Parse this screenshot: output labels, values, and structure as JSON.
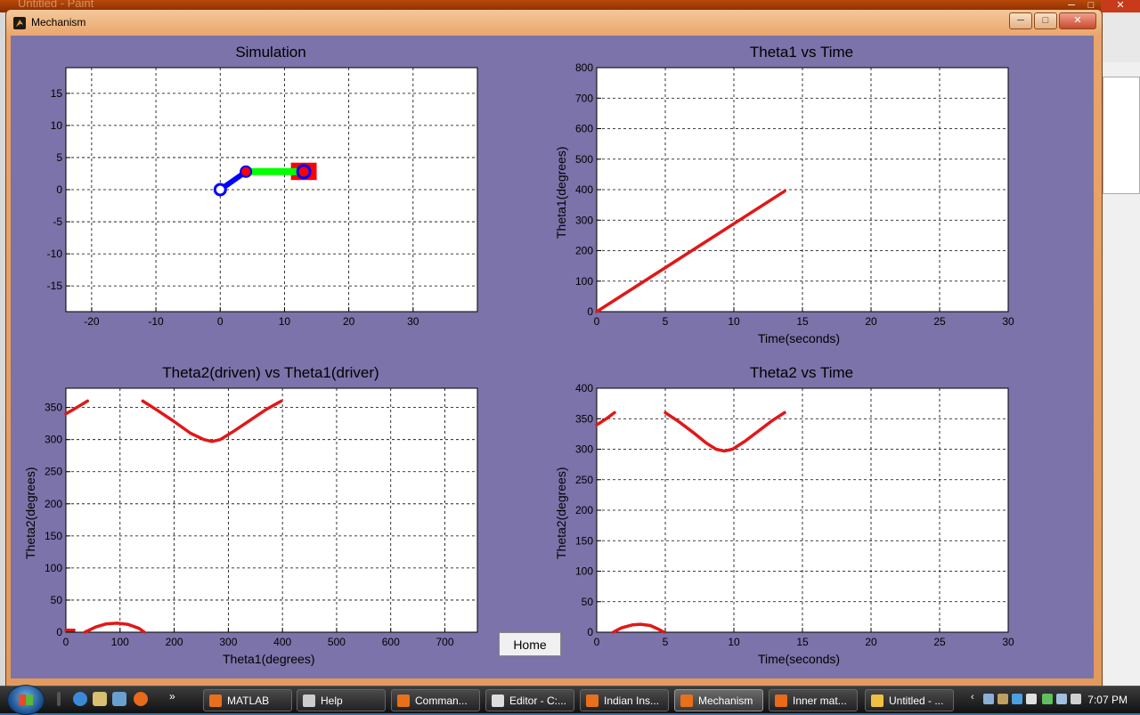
{
  "background_window": {
    "title": "Untitled - Paint"
  },
  "window": {
    "title": "Mechanism",
    "buttons": {
      "minimize": "─",
      "maximize": "□",
      "close": "✕"
    }
  },
  "home_button": {
    "label": "Home"
  },
  "colors": {
    "client_bg": "#7b73a9",
    "plot_line": "#e01818",
    "link_green": "#00ff00",
    "link_blue": "#0000ff",
    "slider_red": "#ff0000"
  },
  "chart_data": [
    {
      "type": "scatter",
      "title": "Simulation",
      "xlabel": "",
      "ylabel": "",
      "xlim": [
        -24,
        40
      ],
      "ylim": [
        -19,
        19
      ],
      "xticks": [
        -20,
        -10,
        0,
        10,
        20,
        30
      ],
      "yticks": [
        -15,
        -10,
        -5,
        0,
        5,
        10,
        15
      ],
      "grid": true,
      "mechanism": {
        "ground_pivot": [
          0,
          0
        ],
        "crank_end": [
          4,
          2.8
        ],
        "slider_pin": [
          13,
          2.8
        ],
        "slider_block": {
          "x": [
            11,
            15
          ],
          "y": [
            1.5,
            4.2
          ]
        }
      }
    },
    {
      "type": "line",
      "title": "Theta1 vs Time",
      "xlabel": "Time(seconds)",
      "ylabel": "Theta1(degrees)",
      "xlim": [
        0,
        30
      ],
      "ylim": [
        0,
        800
      ],
      "xticks": [
        0,
        5,
        10,
        15,
        20,
        25,
        30
      ],
      "yticks": [
        0,
        100,
        200,
        300,
        400,
        500,
        600,
        700,
        800
      ],
      "grid": true,
      "series": [
        {
          "segments": [
            [
              [
                0,
                0
              ],
              [
                13.7,
                395
              ]
            ]
          ]
        }
      ]
    },
    {
      "type": "line",
      "title": "Theta2(driven) vs Theta1(driver)",
      "xlabel": "Theta1(degrees)",
      "ylabel": "Theta2(degrees)",
      "xlim": [
        0,
        760
      ],
      "ylim": [
        0,
        380
      ],
      "xticks": [
        0,
        100,
        200,
        300,
        400,
        500,
        600,
        700
      ],
      "yticks": [
        0,
        50,
        100,
        150,
        200,
        250,
        300,
        350
      ],
      "grid": true,
      "series": [
        {
          "segments": [
            [
              [
                0,
                340
              ],
              [
                20,
                350
              ],
              [
                40,
                360
              ]
            ],
            [
              [
                142,
                360
              ],
              [
                170,
                345
              ],
              [
                200,
                328
              ],
              [
                230,
                310
              ],
              [
                255,
                300
              ],
              [
                270,
                297
              ],
              [
                285,
                300
              ],
              [
                310,
                313
              ],
              [
                340,
                330
              ],
              [
                370,
                347
              ],
              [
                398,
                360
              ]
            ],
            [
              [
                0,
                3
              ],
              [
                15,
                3
              ]
            ],
            [
              [
                35,
                0
              ],
              [
                55,
                8
              ],
              [
                75,
                13
              ],
              [
                95,
                14
              ],
              [
                115,
                12
              ],
              [
                135,
                6
              ],
              [
                145,
                0
              ]
            ]
          ]
        }
      ]
    },
    {
      "type": "line",
      "title": "Theta2 vs Time",
      "xlabel": "Time(seconds)",
      "ylabel": "Theta2(degrees)",
      "xlim": [
        0,
        30
      ],
      "ylim": [
        0,
        400
      ],
      "xticks": [
        0,
        5,
        10,
        15,
        20,
        25,
        30
      ],
      "yticks": [
        0,
        50,
        100,
        150,
        200,
        250,
        300,
        350,
        400
      ],
      "grid": true,
      "series": [
        {
          "segments": [
            [
              [
                0,
                340
              ],
              [
                0.7,
                350
              ],
              [
                1.3,
                360
              ]
            ],
            [
              [
                5,
                360
              ],
              [
                6,
                345
              ],
              [
                7,
                328
              ],
              [
                8,
                310
              ],
              [
                8.7,
                300
              ],
              [
                9.3,
                297
              ],
              [
                9.9,
                300
              ],
              [
                10.8,
                313
              ],
              [
                11.8,
                330
              ],
              [
                12.8,
                347
              ],
              [
                13.7,
                360
              ]
            ],
            [
              [
                1.2,
                0
              ],
              [
                1.8,
                7
              ],
              [
                2.6,
                12
              ],
              [
                3.2,
                13
              ],
              [
                3.9,
                11
              ],
              [
                4.5,
                5
              ],
              [
                4.9,
                0
              ]
            ]
          ]
        }
      ]
    }
  ],
  "taskbar": {
    "items": [
      {
        "label": "MATLAB",
        "icon": "matlab-icon",
        "color": "#e8701a"
      },
      {
        "label": "Help",
        "icon": "help-icon",
        "color": "#cccccc"
      },
      {
        "label": "Comman...",
        "icon": "matlab-icon",
        "color": "#e8701a"
      },
      {
        "label": "Editor - C:...",
        "icon": "editor-icon",
        "color": "#dddddd"
      },
      {
        "label": "Indian Ins...",
        "icon": "matlab-icon",
        "color": "#e8701a"
      },
      {
        "label": "Mechanism",
        "icon": "matlab-icon",
        "color": "#e8701a",
        "active": true
      },
      {
        "label": "Inner mat...",
        "icon": "firefox-icon",
        "color": "#e86a1a"
      },
      {
        "label": "Untitled - ...",
        "icon": "paint-icon",
        "color": "#f0c040"
      }
    ],
    "clock": "7:07 PM"
  }
}
